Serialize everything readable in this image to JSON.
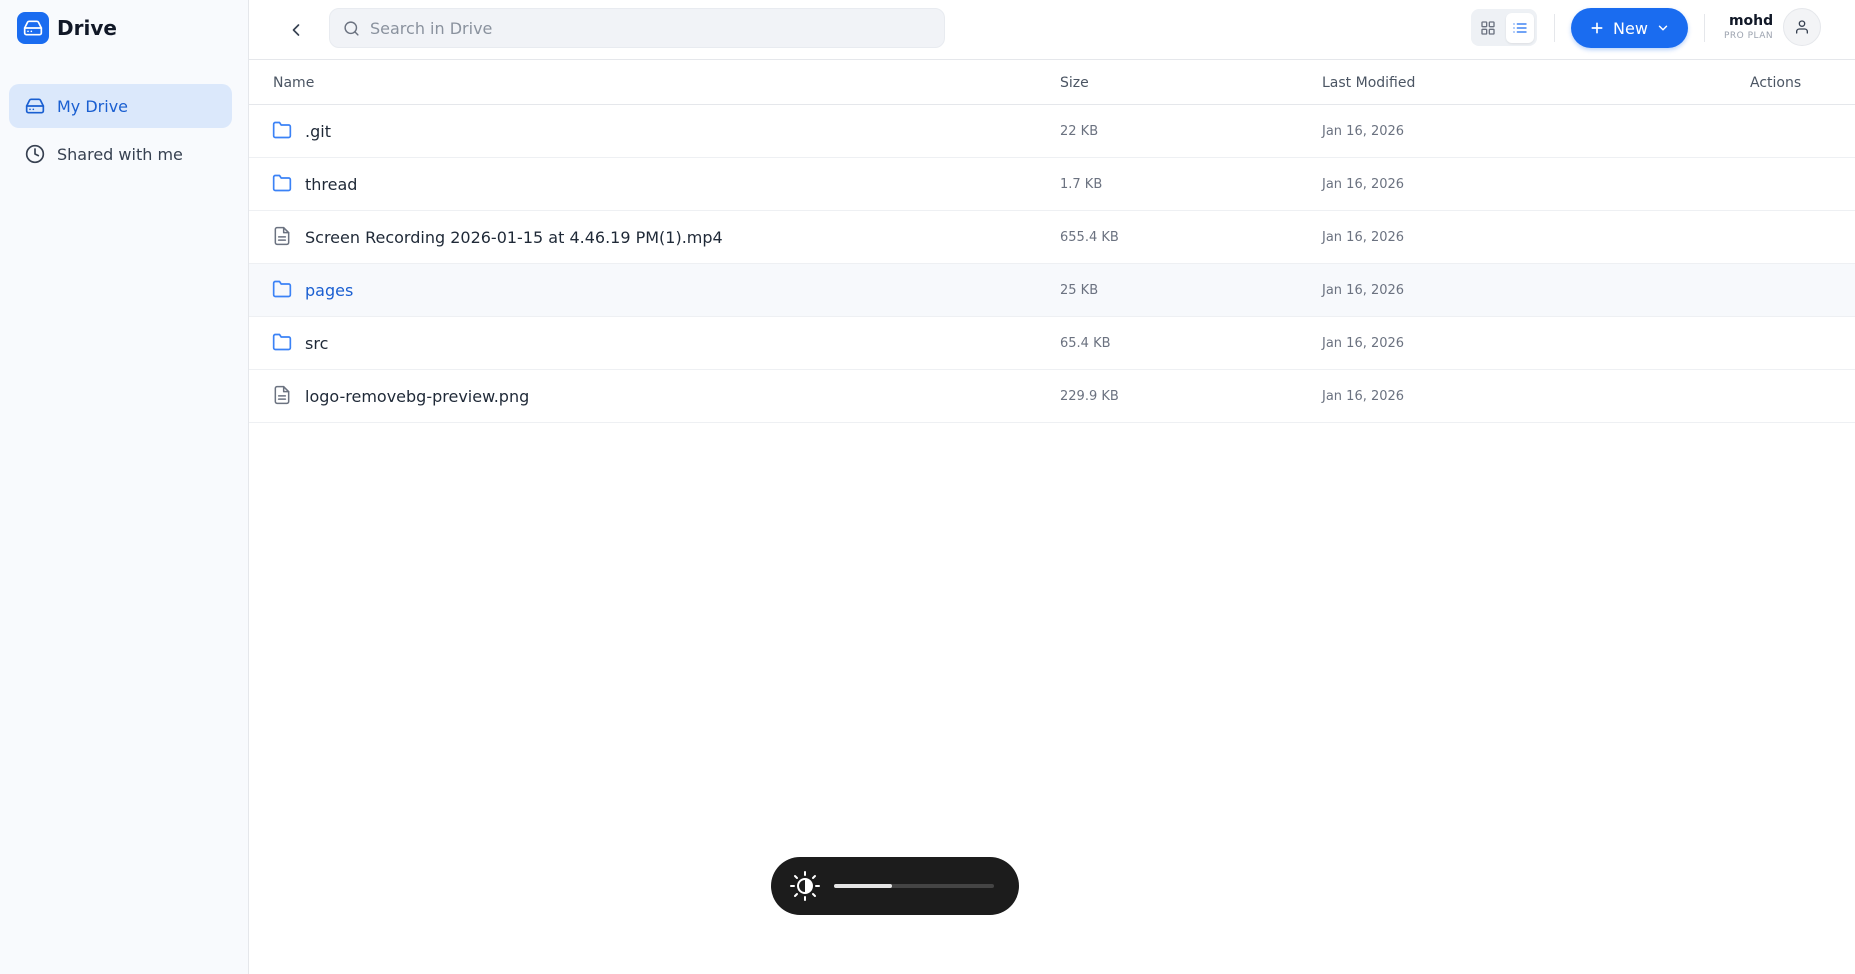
{
  "app": {
    "name": "Drive"
  },
  "sidebar": {
    "items": [
      {
        "label": "My Drive",
        "icon": "drive-icon",
        "active": true
      },
      {
        "label": "Shared with me",
        "icon": "clock-icon",
        "active": false
      }
    ]
  },
  "header": {
    "search_placeholder": "Search in Drive",
    "new_label": "New",
    "view_mode": "list",
    "user": {
      "name": "mohd",
      "plan": "PRO PLAN"
    }
  },
  "table": {
    "columns": {
      "name": "Name",
      "size": "Size",
      "modified": "Last Modified",
      "actions": "Actions"
    },
    "rows": [
      {
        "name": ".git",
        "type": "folder",
        "size": "22 KB",
        "modified": "Jan 16, 2026"
      },
      {
        "name": "thread",
        "type": "folder",
        "size": "1.7 KB",
        "modified": "Jan 16, 2026"
      },
      {
        "name": "Screen Recording 2026-01-15 at 4.46.19 PM(1).mp4",
        "type": "file",
        "size": "655.4 KB",
        "modified": "Jan 16, 2026"
      },
      {
        "name": "pages",
        "type": "folder",
        "size": "25 KB",
        "modified": "Jan 16, 2026"
      },
      {
        "name": "src",
        "type": "folder",
        "size": "65.4 KB",
        "modified": "Jan 16, 2026"
      },
      {
        "name": "logo-removebg-preview.png",
        "type": "file",
        "size": "229.9 KB",
        "modified": "Jan 16, 2026"
      }
    ]
  },
  "brightness": {
    "level": 0.36,
    "icon": "brightness-icon"
  },
  "colors": {
    "accent": "#1a6cf0",
    "active_nav_bg": "#dbe8fb",
    "folder": "#3b82f6"
  }
}
